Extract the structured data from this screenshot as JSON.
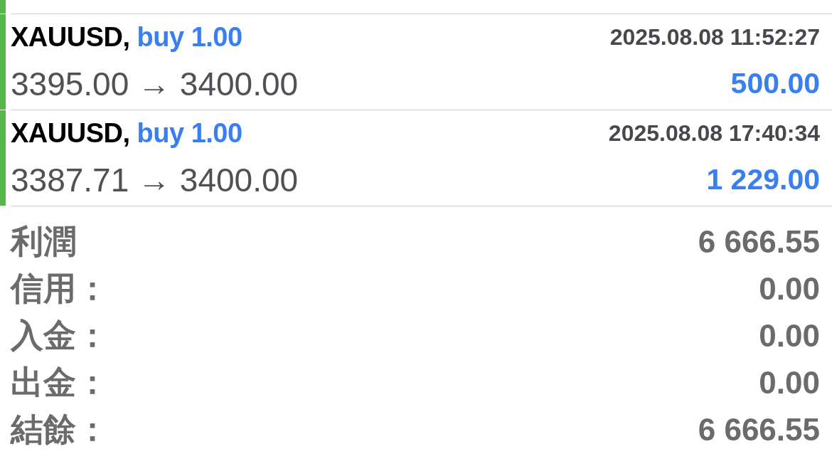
{
  "deals": [
    {
      "symbol": "XAUUSD,",
      "order": "buy 1.00",
      "time": "2025.08.08 11:52:27",
      "prices": "3395.00 → 3400.00",
      "profit": "500.00"
    },
    {
      "symbol": "XAUUSD,",
      "order": "buy 1.00",
      "time": "2025.08.08 17:40:34",
      "prices": "3387.71 → 3400.00",
      "profit": "1 229.00"
    }
  ],
  "summary": [
    {
      "label": "利潤",
      "value": "6 666.55"
    },
    {
      "label": "信用：",
      "value": "0.00"
    },
    {
      "label": "入金：",
      "value": "0.00"
    },
    {
      "label": "出金：",
      "value": "0.00"
    },
    {
      "label": "結餘：",
      "value": "6 666.55"
    }
  ]
}
